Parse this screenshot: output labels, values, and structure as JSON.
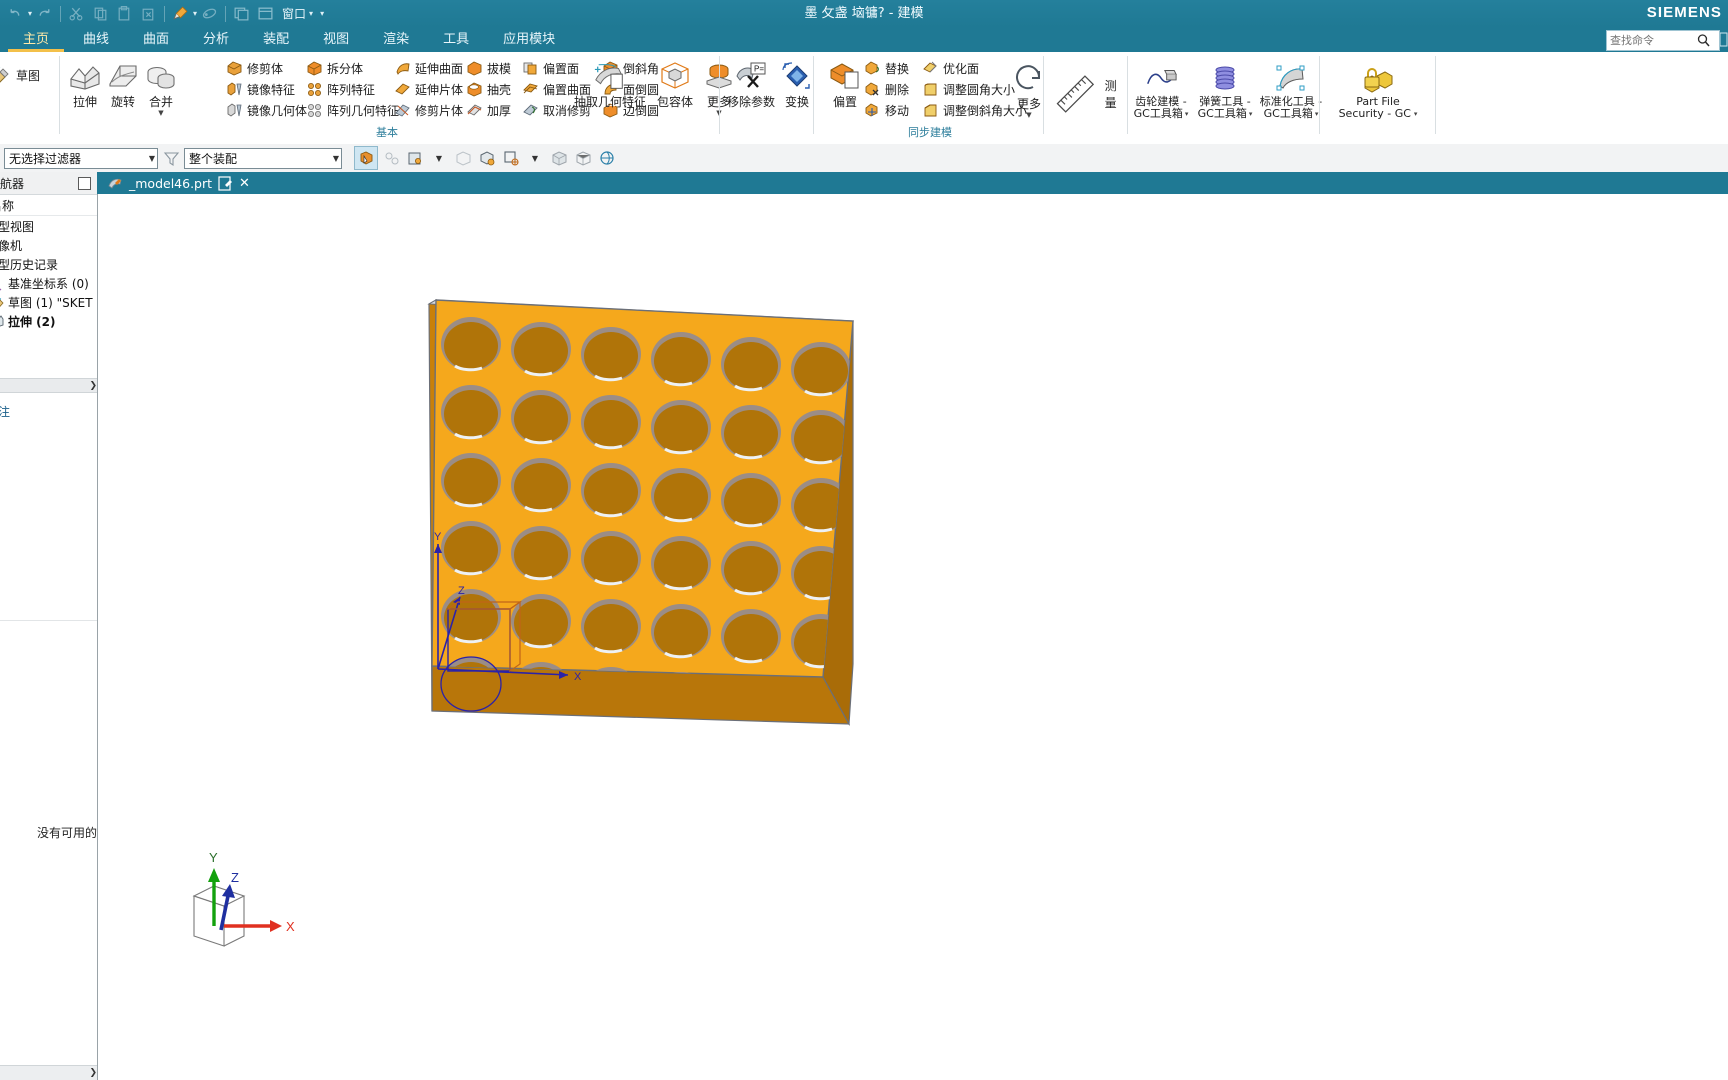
{
  "window": {
    "title": "墨  攵盏  垴镛? - 建模",
    "brand": "SIEMENS"
  },
  "quick_access": {
    "items": [
      {
        "name": "undo-icon",
        "glyph": "undo"
      },
      {
        "name": "redo-icon",
        "glyph": "redo"
      },
      {
        "name": "cut-icon",
        "glyph": "cut"
      },
      {
        "name": "copy-icon",
        "glyph": "copy"
      },
      {
        "name": "paste-icon",
        "glyph": "paste"
      },
      {
        "name": "delete-icon",
        "glyph": "delete"
      },
      {
        "name": "paintbrush-icon",
        "glyph": "brush"
      },
      {
        "name": "eraser-icon",
        "glyph": "eraser"
      },
      {
        "name": "tile-windows-icon",
        "glyph": "tile"
      },
      {
        "name": "window-icon",
        "glyph": "window"
      }
    ],
    "window_label": "窗口"
  },
  "search": {
    "placeholder": "查找命令",
    "value": ""
  },
  "ribbon": {
    "tabs": [
      {
        "label": "主页",
        "active": true
      },
      {
        "label": "曲线",
        "active": false
      },
      {
        "label": "曲面",
        "active": false
      },
      {
        "label": "分析",
        "active": false
      },
      {
        "label": "装配",
        "active": false
      },
      {
        "label": "视图",
        "active": false
      },
      {
        "label": "渲染",
        "active": false
      },
      {
        "label": "工具",
        "active": false
      },
      {
        "label": "应用模块",
        "active": false
      }
    ],
    "groups": [
      {
        "name": "sketch-group",
        "label": "",
        "big": [
          {
            "label": "草图",
            "icon": "sketch-icon"
          }
        ]
      },
      {
        "name": "feature-group",
        "label": "基本",
        "big": [
          {
            "label": "拉伸",
            "icon": "extrude-icon"
          },
          {
            "label": "旋转",
            "icon": "revolve-icon"
          },
          {
            "label": "合并",
            "icon": "unite-icon",
            "dropdown": true
          }
        ],
        "cols": [
          [
            "修剪体",
            "镜像特征",
            "镜像几何体"
          ],
          [
            "拆分体",
            "阵列特征",
            "阵列几何特征"
          ],
          [
            "延伸曲面",
            "延伸片体",
            "修剪片体"
          ],
          [
            "拔模",
            "抽壳",
            "加厚"
          ],
          [
            "偏置面",
            "偏置曲面",
            "取消修剪"
          ],
          [
            "倒斜角",
            "面倒圆",
            "边倒圆"
          ]
        ],
        "big_tail": [
          {
            "label": "抽取几何特征",
            "icon": "extract-geometry-icon"
          },
          {
            "label": "包容体",
            "icon": "bounding-body-icon"
          },
          {
            "label": "更多",
            "icon": "more-features-icon",
            "dropdown": true
          }
        ]
      },
      {
        "name": "edit-feature-group",
        "label": "",
        "big": [
          {
            "label": "移除参数",
            "icon": "remove-parameters-icon"
          },
          {
            "label": "变换",
            "icon": "transform-icon"
          }
        ]
      },
      {
        "name": "synchronous-modeling-group",
        "label": "同步建模",
        "big": [
          {
            "label": "偏置",
            "icon": "offset-region-icon"
          }
        ],
        "cols": [
          [
            "替换",
            "删除",
            "移动"
          ],
          [
            "优化面",
            "调整圆角大小",
            "调整倒斜角大小"
          ]
        ],
        "big_tail": [
          {
            "label": "更多",
            "icon": "more-sync-icon",
            "dropdown": true
          }
        ]
      },
      {
        "name": "measure-group",
        "label": "",
        "big": [
          {
            "label": "测量",
            "icon": "measure-ruler-icon"
          }
        ]
      },
      {
        "name": "gc-toolbox-group",
        "label": "",
        "big": [
          {
            "label": "齿轮建模 -",
            "label2": "GC工具箱",
            "icon": "gear-modeling-icon",
            "dropdown": true
          },
          {
            "label": "弹簧工具 -",
            "label2": "GC工具箱",
            "icon": "spring-tool-icon",
            "dropdown": true
          },
          {
            "label": "标准化工具 -",
            "label2": "GC工具箱",
            "icon": "standardization-tool-icon",
            "dropdown": true
          }
        ]
      },
      {
        "name": "part-file-security-group",
        "label": "",
        "big": [
          {
            "label": "Part File",
            "label2": "Security - GC",
            "icon": "part-file-security-icon",
            "dropdown": true
          }
        ]
      }
    ]
  },
  "selection_bar": {
    "filter_value": "无选择过滤器",
    "scope_value": "整个装配",
    "icons": [
      {
        "name": "select-general-icon",
        "pressed": true
      },
      {
        "name": "select-feature-icon",
        "pressed": false
      },
      {
        "name": "snap-point-icon",
        "pressed": false
      },
      {
        "name": "snap-point-dropdown",
        "pressed": false
      },
      {
        "name": "face-select-icon",
        "pressed": false
      },
      {
        "name": "body-select-icon",
        "pressed": false
      },
      {
        "name": "wcs-select-icon",
        "pressed": false
      },
      {
        "name": "wcs-dropdown",
        "pressed": false
      },
      {
        "name": "shaded-view-icon",
        "pressed": false
      },
      {
        "name": "wireframe-view-icon",
        "pressed": false
      },
      {
        "name": "render-style-icon",
        "pressed": false
      }
    ]
  },
  "navigator": {
    "header": "导航器",
    "sections": [
      "名称"
    ],
    "rows": [
      {
        "label": "模型视图",
        "icon": "folder-icon",
        "bold": false,
        "indent": 0
      },
      {
        "label": "摄像机",
        "icon": "camera-icon",
        "bold": false,
        "indent": 0
      },
      {
        "label": "模型历史记录",
        "icon": "history-icon",
        "bold": false,
        "indent": 0
      },
      {
        "label": "基准坐标系 (0)",
        "icon": "datum-csys-icon",
        "bold": false,
        "indent": 1
      },
      {
        "label": "草图 (1) \"SKET",
        "icon": "sketch-node-icon",
        "bold": false,
        "indent": 1
      },
      {
        "label": "拉伸 (2)",
        "icon": "extrude-node-icon",
        "bold": true,
        "indent": 1
      }
    ],
    "detail_label": "注",
    "status_note": "没有可用的"
  },
  "document": {
    "tab_label": "_model46.prt",
    "modified_marker": "✎",
    "close_label": "✕"
  },
  "viewport": {
    "triad": {
      "x_label": "X",
      "y_label": "Y",
      "z_label": "Z",
      "x_color": "#e03020",
      "y_color": "#13a10e",
      "z_color": "#1f2fa0"
    },
    "model": {
      "name": "perforated-plate",
      "top_face_color": "#f5a81c",
      "side_face_color": "#c98009",
      "front_face_color": "#b8760a",
      "hole_inner_color": "#b07409",
      "hole_rim_color": "#9b8d86",
      "edge_color": "#6b6f78",
      "rows": 6,
      "cols": 6,
      "sketch_color": "#3a35b5",
      "sketch_curve_color": "#c06418"
    }
  }
}
